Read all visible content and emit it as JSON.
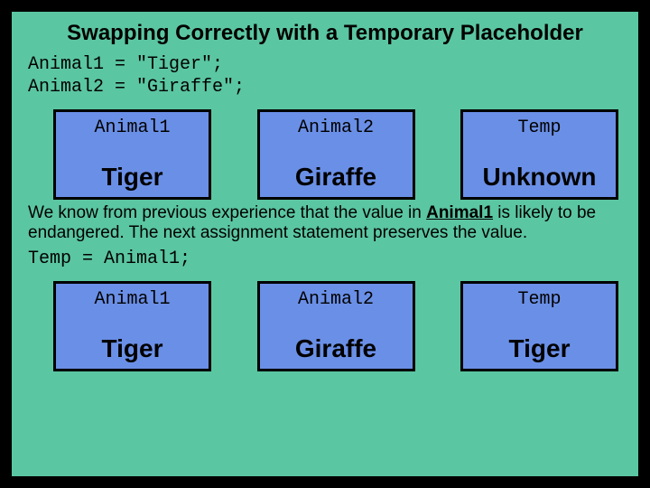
{
  "title": "Swapping Correctly with a Temporary Placeholder",
  "code1_line1": "Animal1 = \"Tiger\";",
  "code1_line2": "Animal2 = \"Giraffe\";",
  "row1": {
    "b1": {
      "label": "Animal1",
      "value": "Tiger"
    },
    "b2": {
      "label": "Animal2",
      "value": "Giraffe"
    },
    "b3": {
      "label": "Temp",
      "value": "Unknown"
    }
  },
  "para_pre": "We know from previous experience that the value in ",
  "para_bold": "Animal1",
  "para_post": " is likely to be endangered.  The next assignment statement preserves the value.",
  "code2": "Temp = Animal1;",
  "row2": {
    "b1": {
      "label": "Animal1",
      "value": "Tiger"
    },
    "b2": {
      "label": "Animal2",
      "value": "Giraffe"
    },
    "b3": {
      "label": "Temp",
      "value": "Tiger"
    }
  }
}
